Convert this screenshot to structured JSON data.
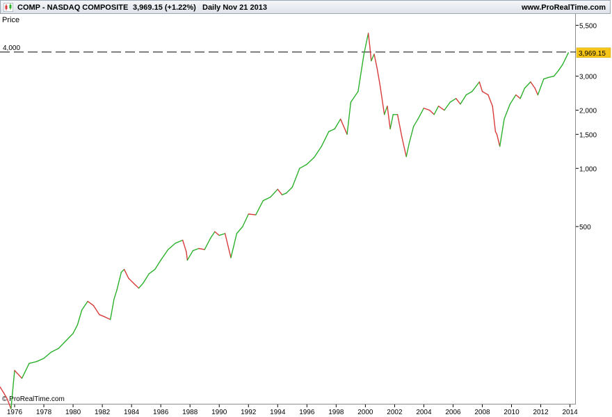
{
  "header": {
    "symbol_title": "COMP - NASDAQ COMPOSITE",
    "price_change": "3,969.15 (+1.22%)",
    "period": "Daily  Nov 21 2013",
    "site": "www.ProRealTime.com",
    "icon": "candlestick-icon"
  },
  "price_axis_label": "Price",
  "copyright": "© ProRealTime.com",
  "colors": {
    "up": "#2bb02b",
    "down": "#d83a3a",
    "last_price_badge": "#f5c518",
    "reference_line": "#000000"
  },
  "chart_data": {
    "type": "line",
    "title": "COMP - NASDAQ COMPOSITE",
    "ylabel": "Price",
    "y_scale": "log",
    "xlim": [
      1975,
      2014.4
    ],
    "ylim": [
      60,
      6300
    ],
    "x_ticks": [
      1976,
      1978,
      1980,
      1982,
      1984,
      1986,
      1988,
      1990,
      1992,
      1994,
      1996,
      1998,
      2000,
      2002,
      2004,
      2006,
      2008,
      2010,
      2012,
      2014
    ],
    "x_tick_labels": [
      "1976",
      "1978",
      "1980",
      "1982",
      "1984",
      "1986",
      "1988",
      "1990",
      "1992",
      "1994",
      "1996",
      "1998",
      "2000",
      "2002",
      "2004",
      "2006",
      "2008",
      "2010",
      "2012",
      "2014"
    ],
    "y_ticks": [
      500,
      1000,
      1500,
      2000,
      3000,
      5500
    ],
    "y_tick_labels": [
      "500",
      "1,000",
      "1,500",
      "2,000",
      "3,000",
      "5,500"
    ],
    "reference_line": {
      "value": 4000,
      "label": "4,000",
      "style": "dashed"
    },
    "last_price": {
      "value": 3969.15,
      "label": "3,969.15"
    },
    "series": [
      {
        "x": [
          1975.0,
          1975.25,
          1975.5,
          1975.75,
          1976.0,
          1976.5,
          1977.0,
          1977.5,
          1978.0,
          1978.5,
          1979.0,
          1979.5,
          1980.0,
          1980.3,
          1980.6,
          1981.0,
          1981.4,
          1981.8,
          1982.2,
          1982.55,
          1982.8,
          1983.0,
          1983.3,
          1983.5,
          1983.8,
          1984.2,
          1984.5,
          1984.8,
          1985.2,
          1985.6,
          1986.0,
          1986.5,
          1987.0,
          1987.5,
          1987.75,
          1987.82,
          1988.2,
          1988.6,
          1989.0,
          1989.4,
          1989.7,
          1990.0,
          1990.4,
          1990.8,
          1991.2,
          1991.6,
          1992.0,
          1992.5,
          1993.0,
          1993.5,
          1994.0,
          1994.3,
          1994.6,
          1995.0,
          1995.5,
          1996.0,
          1996.5,
          1997.0,
          1997.5,
          1997.9,
          1998.3,
          1998.75,
          1999.0,
          1999.5,
          1999.9,
          2000.2,
          2000.3,
          2000.4,
          2000.6,
          2000.8,
          2001.0,
          2001.3,
          2001.5,
          2001.7,
          2001.9,
          2002.2,
          2002.5,
          2002.8,
          2003.0,
          2003.3,
          2003.6,
          2004.0,
          2004.4,
          2004.7,
          2005.0,
          2005.4,
          2005.8,
          2006.2,
          2006.5,
          2006.9,
          2007.3,
          2007.8,
          2008.0,
          2008.4,
          2008.7,
          2008.9,
          2009.0,
          2009.2,
          2009.5,
          2009.9,
          2010.3,
          2010.6,
          2010.9,
          2011.3,
          2011.6,
          2011.8,
          2012.2,
          2012.5,
          2012.9,
          2013.2,
          2013.5,
          2013.89
        ],
        "values": [
          74,
          69,
          64,
          57,
          90,
          82,
          98,
          100,
          104,
          112,
          117,
          128,
          140,
          155,
          185,
          205,
          195,
          175,
          170,
          165,
          210,
          235,
          290,
          300,
          270,
          252,
          240,
          255,
          285,
          300,
          335,
          380,
          410,
          425,
          370,
          335,
          375,
          385,
          380,
          435,
          470,
          450,
          460,
          345,
          460,
          500,
          580,
          575,
          680,
          710,
          780,
          730,
          745,
          800,
          1000,
          1050,
          1140,
          1300,
          1550,
          1600,
          1800,
          1500,
          2200,
          2500,
          3900,
          5000,
          4300,
          3600,
          3900,
          3300,
          2700,
          1900,
          2100,
          1600,
          1900,
          1900,
          1450,
          1150,
          1350,
          1650,
          1800,
          2050,
          2000,
          1900,
          2100,
          2000,
          2200,
          2300,
          2150,
          2400,
          2500,
          2800,
          2500,
          2400,
          2100,
          1550,
          1500,
          1300,
          1800,
          2150,
          2400,
          2300,
          2600,
          2800,
          2600,
          2400,
          2900,
          2950,
          3000,
          3200,
          3450,
          3969.15
        ]
      }
    ]
  }
}
